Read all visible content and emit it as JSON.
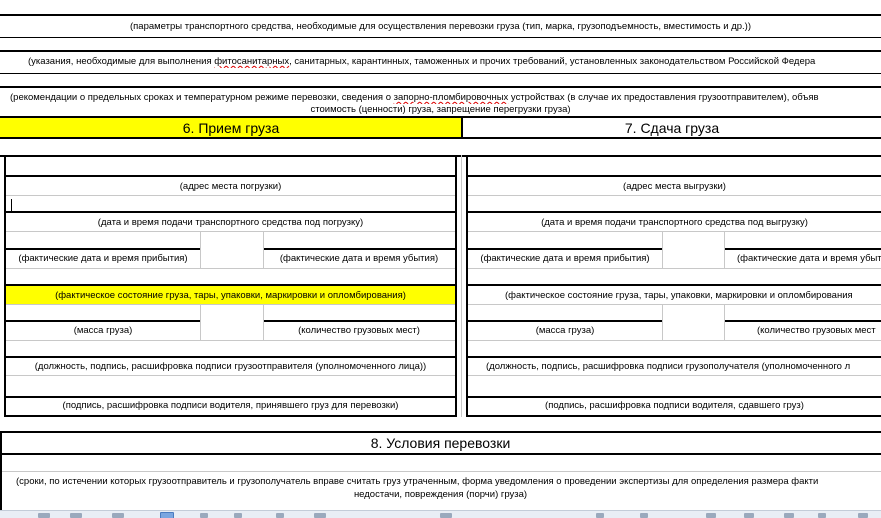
{
  "document": {
    "cargo_transport_params": "(параметры транспортного средства, необходимые для осуществления перевозки груза (тип, марка, грузоподъемность, вместимость и др.))",
    "instructions_prefix": "(указания, необходимые для выполнения ",
    "instructions_misspelled": "фитосанитарных",
    "instructions_suffix": ", санитарных, карантинных, таможенных и прочих требований, установленных законодательством Российской Федера",
    "recommendations_part1": "(рекомендации о предельных сроках и температурном режиме перевозки, сведения о ",
    "recommendations_misspelled": "запорно-пломбировочных",
    "recommendations_part2": " устройствах (в случае их предоставления грузоотправителем), объяв",
    "recommendations_line2": "стоимость (ценности) груза, запрещение перегрузки груза)"
  },
  "section6": {
    "title": "6. Прием груза",
    "loading_address": "(адрес места погрузки)",
    "vehicle_arrival_datetime": "(дата и время подачи транспортного средства под погрузку)",
    "actual_arrival": "(фактические дата и время прибытия)",
    "actual_departure": "(фактические дата и время убытия)",
    "cargo_condition": "(фактическое состояние груза, тары, упаковки, маркировки и опломбирования)",
    "cargo_mass": "(масса груза)",
    "places_count": "(количество грузовых мест)",
    "shipper_signature": "(должность, подпись, расшифровка подписи грузоотправителя (уполномоченного лица))",
    "driver_signature": "(подпись, расшифровка подписи водителя, принявшего груз для перевозки)"
  },
  "section7": {
    "title": "7. Сдача груза",
    "unloading_address": "(адрес места выгрузки)",
    "vehicle_arrival_datetime": "(дата и время подачи транспортного средства под выгрузку)",
    "actual_arrival": "(фактические дата и время прибытия)",
    "actual_departure": "(фактические дата и время убыти",
    "cargo_condition": "(фактическое состояние груза, тары, упаковки, маркировки и опломбирования",
    "cargo_mass": "(масса груза)",
    "places_count": "(количество грузовых мест",
    "consignee_signature": "(должность, подпись, расшифровка подписи грузополучателя (уполномоченного л",
    "driver_signature": "(подпись, расшифровка подписи водителя, сдавшего груз)"
  },
  "section8": {
    "title": "8. Условия перевозки",
    "terms_line1": "(сроки, по истечении которых грузоотправитель и грузополучатель вправе считать груз утраченным, форма уведомления о проведении экспертизы для определения размера факти",
    "terms_line2": "недостачи, повреждения (порчи) груза)"
  },
  "colors": {
    "highlight": "#ffff00",
    "grid": "#000000",
    "spellcheck": "#dd0000"
  }
}
